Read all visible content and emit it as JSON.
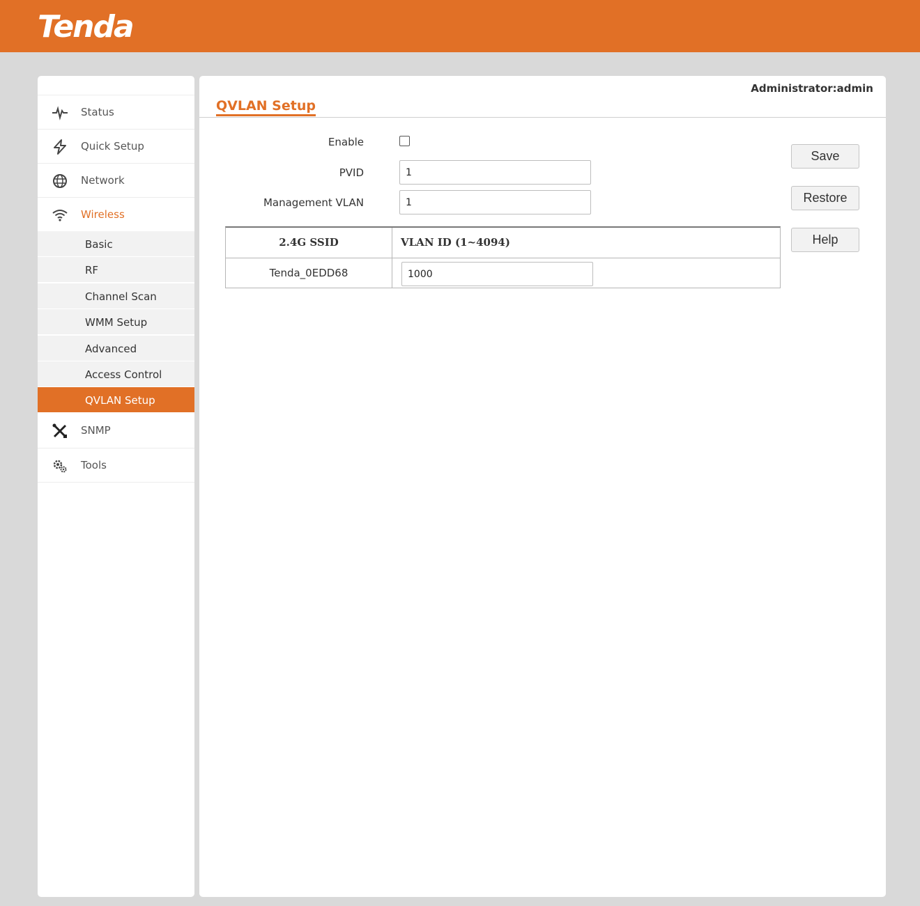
{
  "header": {
    "brand": "Tenda",
    "accent_color": "#e17026"
  },
  "sidebar": {
    "items": [
      {
        "label": "Status",
        "icon": "pulse-icon"
      },
      {
        "label": "Quick Setup",
        "icon": "lightning-icon"
      },
      {
        "label": "Network",
        "icon": "globe-icon"
      },
      {
        "label": "Wireless",
        "icon": "wifi-icon",
        "expanded": true,
        "children": [
          "Basic",
          "RF",
          "Channel Scan",
          "WMM Setup",
          "Advanced",
          "Access Control",
          "QVLAN Setup"
        ],
        "active_child": "QVLAN Setup"
      },
      {
        "label": "SNMP",
        "icon": "tools-cross-icon"
      },
      {
        "label": "Tools",
        "icon": "gears-icon"
      }
    ]
  },
  "main": {
    "admin_label": "Administrator:admin",
    "title": "QVLAN Setup",
    "form": {
      "enable_label": "Enable",
      "enable_checked": false,
      "pvid_label": "PVID",
      "pvid_value": "1",
      "mgmt_vlan_label": "Management VLAN",
      "mgmt_vlan_value": "1"
    },
    "table": {
      "headers": [
        "2.4G SSID",
        "VLAN ID (1~4094)"
      ],
      "rows": [
        {
          "ssid": "Tenda_0EDD68",
          "vlan_id": "1000"
        }
      ]
    },
    "buttons": {
      "save": "Save",
      "restore": "Restore",
      "help": "Help"
    }
  }
}
